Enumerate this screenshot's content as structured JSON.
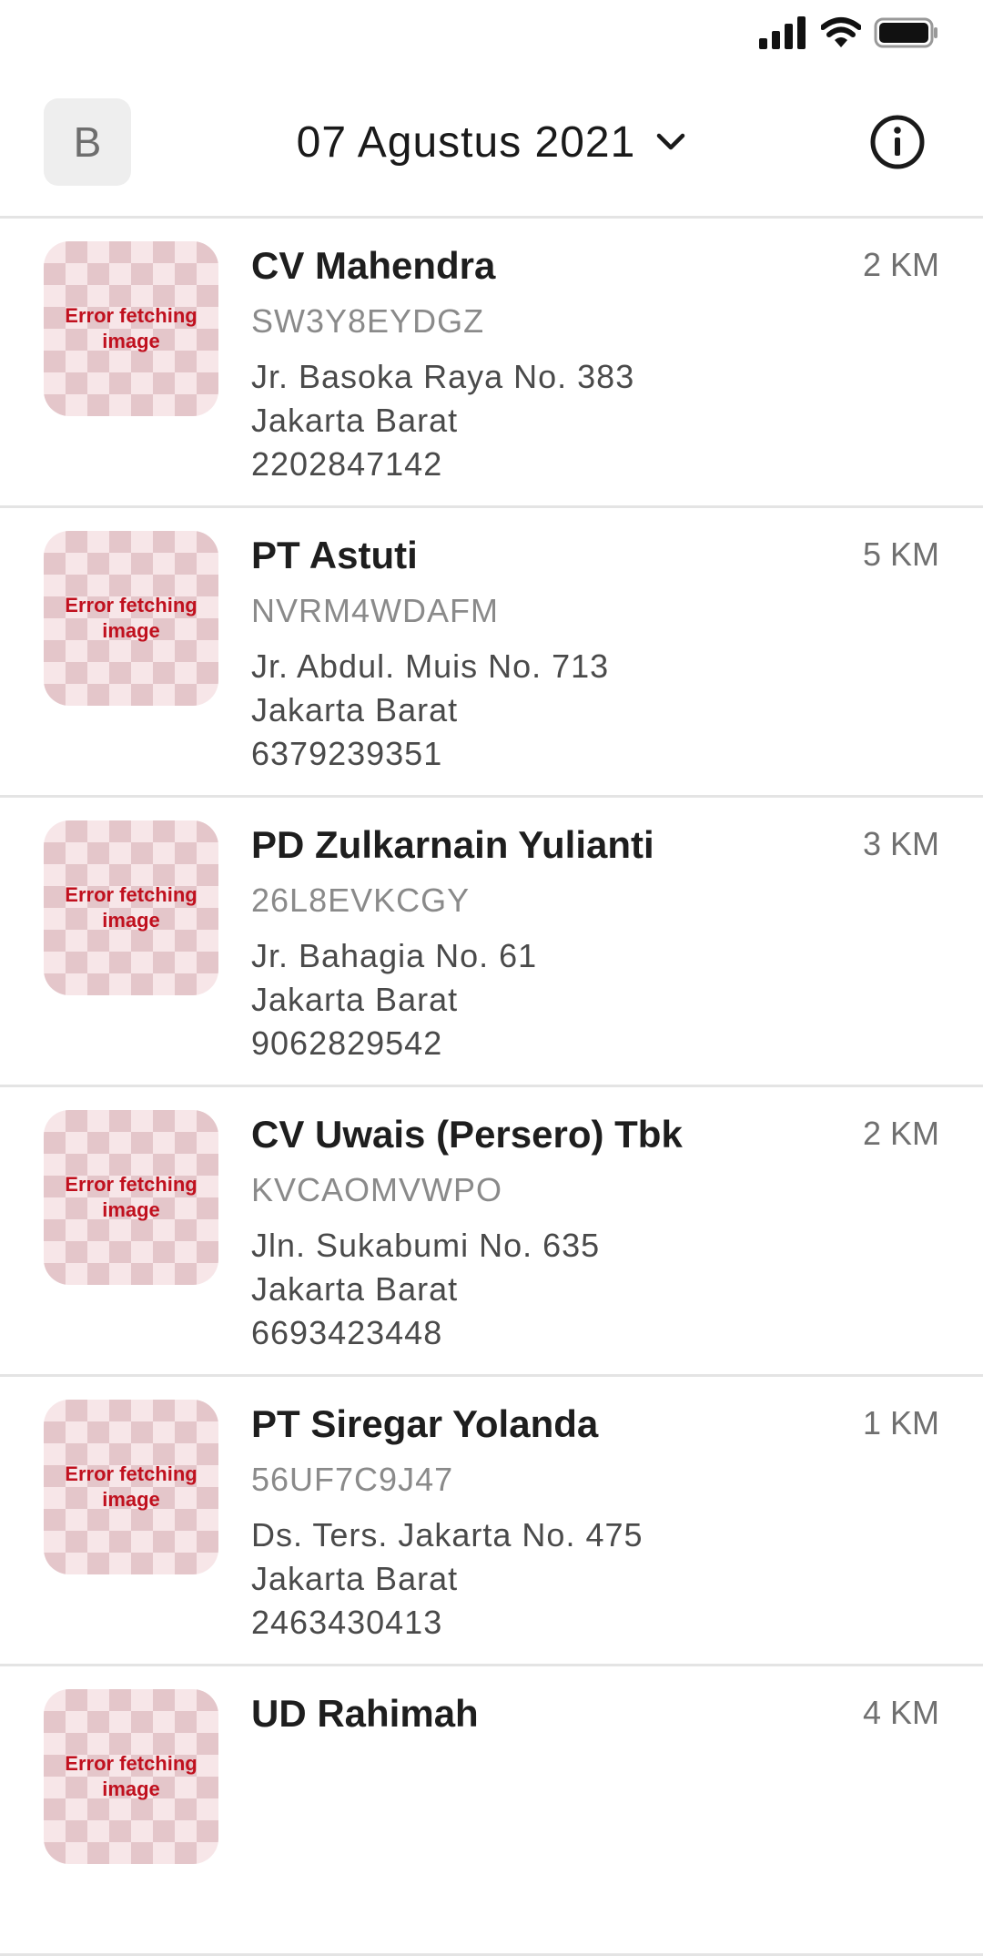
{
  "header": {
    "avatar_initial": "B",
    "date": "07 Agustus 2021"
  },
  "icons": {
    "signal": "signal-icon",
    "wifi": "wifi-icon",
    "battery": "battery-icon",
    "chevron": "chevron-down-icon",
    "info": "info-icon"
  },
  "thumb_error": {
    "line1": "Error fetching",
    "line2": "image"
  },
  "stores": [
    {
      "name": "CV Mahendra",
      "code": "SW3Y8EYDGZ",
      "street": "Jr. Basoka Raya No. 383",
      "city": "Jakarta Barat",
      "phone": "2202847142",
      "distance": "2 KM"
    },
    {
      "name": "PT Astuti",
      "code": "NVRM4WDAFM",
      "street": "Jr. Abdul. Muis No. 713",
      "city": "Jakarta Barat",
      "phone": "6379239351",
      "distance": "5 KM"
    },
    {
      "name": "PD Zulkarnain Yulianti",
      "code": "26L8EVKCGY",
      "street": "Jr. Bahagia No. 61",
      "city": "Jakarta Barat",
      "phone": "9062829542",
      "distance": "3 KM"
    },
    {
      "name": "CV Uwais (Persero) Tbk",
      "code": "KVCAOMVWPO",
      "street": "Jln. Sukabumi No. 635",
      "city": "Jakarta Barat",
      "phone": "6693423448",
      "distance": "2 KM"
    },
    {
      "name": "PT Siregar Yolanda",
      "code": "56UF7C9J47",
      "street": "Ds. Ters. Jakarta No. 475",
      "city": "Jakarta Barat",
      "phone": "2463430413",
      "distance": "1 KM"
    },
    {
      "name": "UD Rahimah",
      "code": "",
      "street": "",
      "city": "",
      "phone": "",
      "distance": "4 KM"
    }
  ]
}
